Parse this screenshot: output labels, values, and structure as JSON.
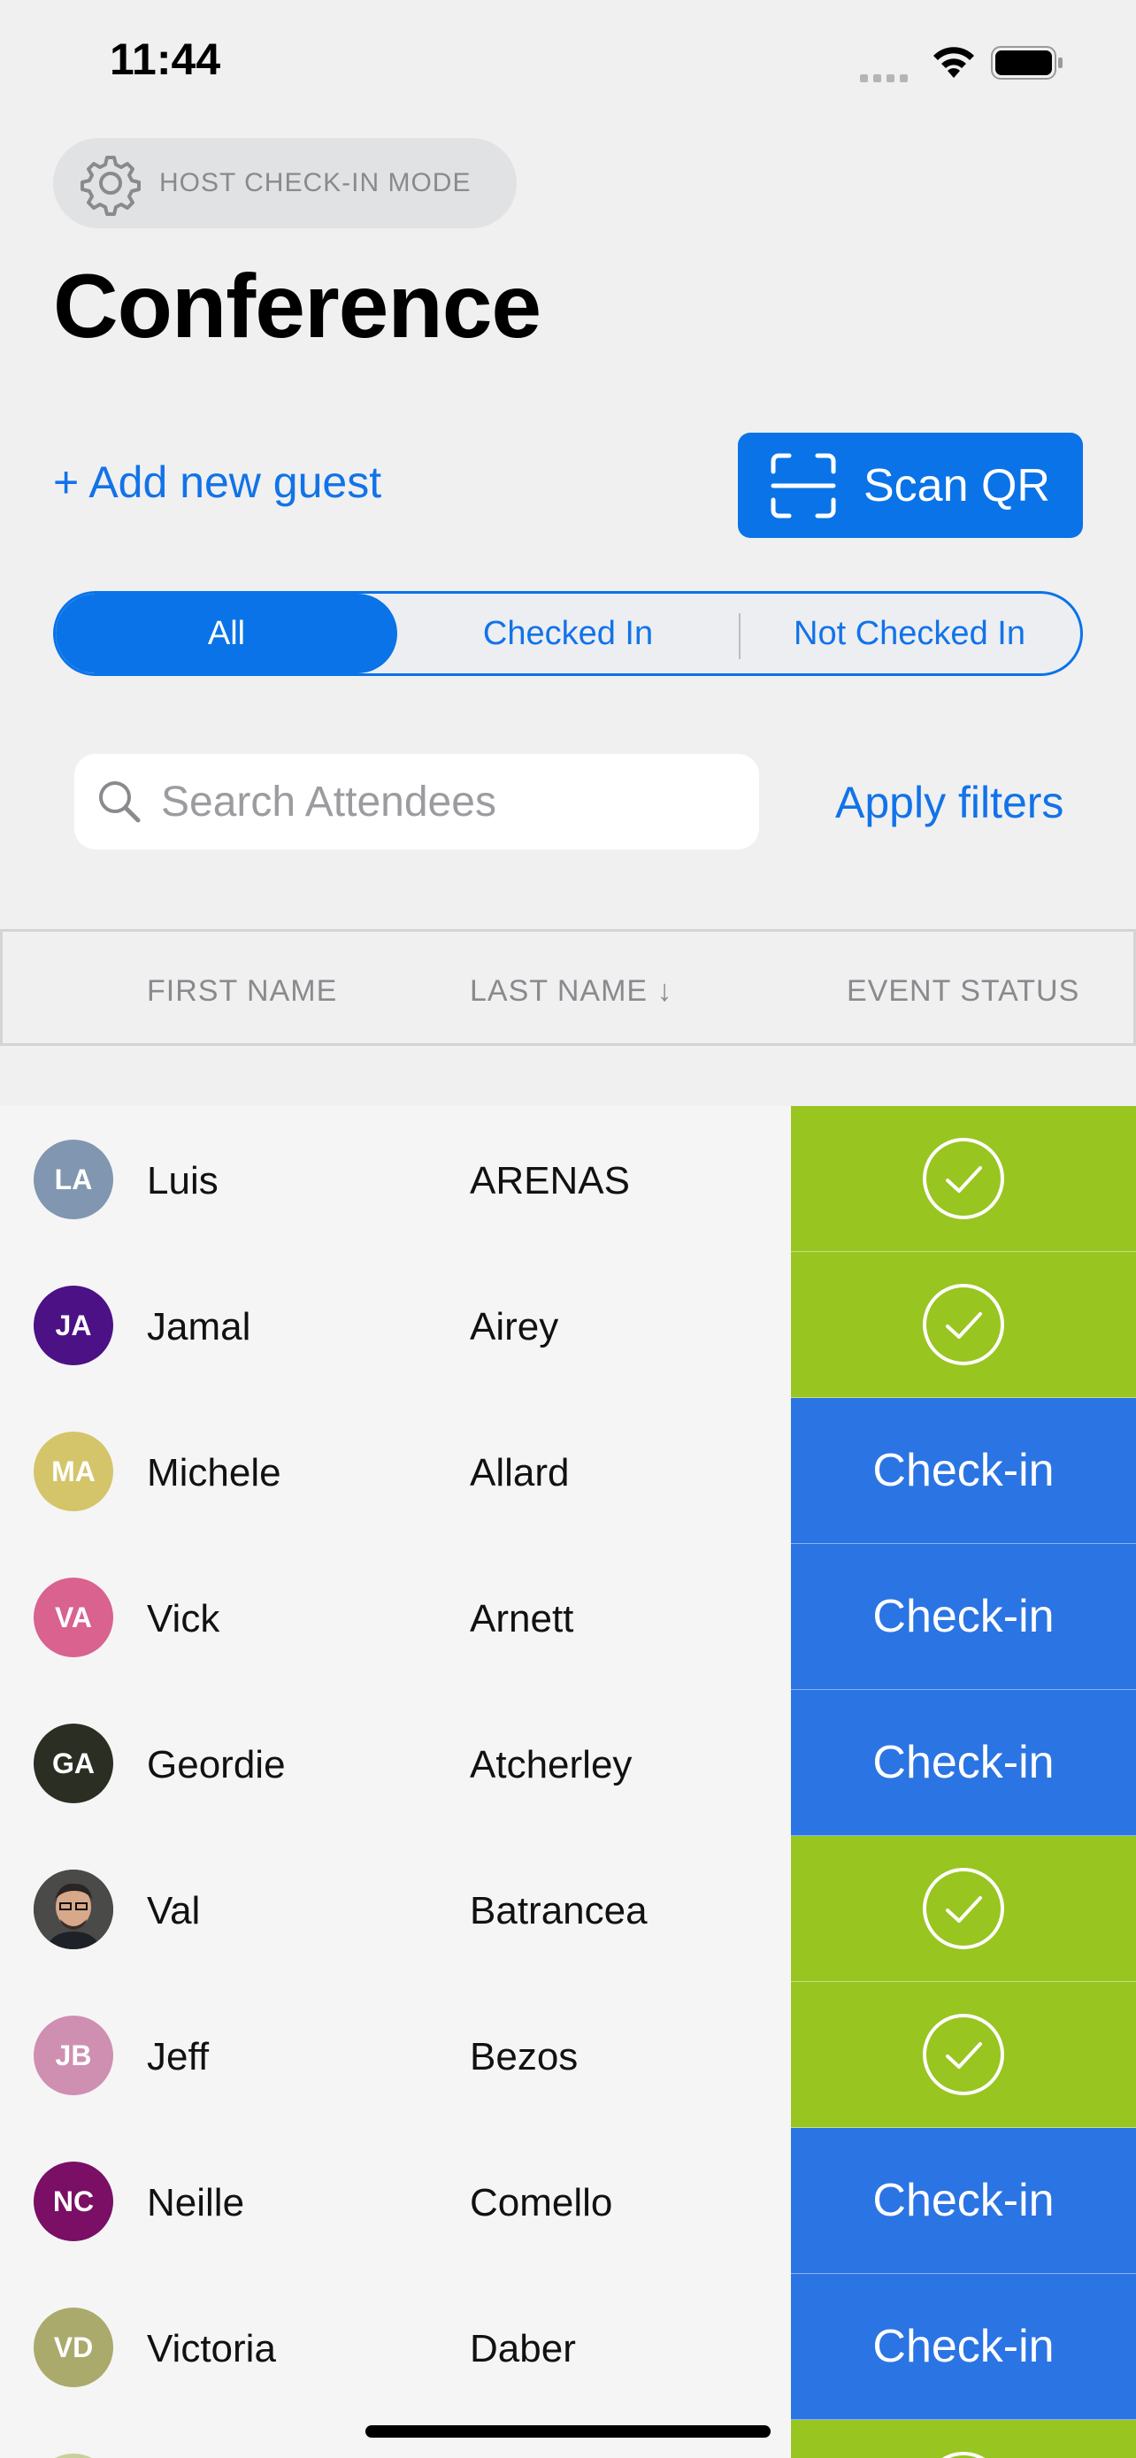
{
  "status_bar": {
    "time": "11:44"
  },
  "header": {
    "mode_label": "HOST CHECK-IN MODE",
    "title": "Conference"
  },
  "actions": {
    "add_guest": "+ Add new guest",
    "scan_qr": "Scan QR"
  },
  "segments": [
    {
      "label": "All",
      "active": true
    },
    {
      "label": "Checked In",
      "active": false
    },
    {
      "label": "Not Checked In",
      "active": false
    }
  ],
  "search": {
    "placeholder": "Search Attendees",
    "value": ""
  },
  "filters": {
    "apply_label": "Apply filters"
  },
  "table": {
    "columns": {
      "first_name": "FIRST NAME",
      "last_name": "LAST NAME ↓",
      "event_status": "EVENT STATUS"
    },
    "checkin_label": "Check-in",
    "rows": [
      {
        "initials": "LA",
        "avatar_color": "#8196b0",
        "first": "Luis",
        "last": "ARENAS",
        "checked_in": true
      },
      {
        "initials": "JA",
        "avatar_color": "#4b1185",
        "first": "Jamal",
        "last": "Airey",
        "checked_in": true
      },
      {
        "initials": "MA",
        "avatar_color": "#d4c56a",
        "first": "Michele",
        "last": "Allard",
        "checked_in": false
      },
      {
        "initials": "VA",
        "avatar_color": "#d9628f",
        "first": "Vick",
        "last": "Arnett",
        "checked_in": false
      },
      {
        "initials": "GA",
        "avatar_color": "#2b2e22",
        "first": "Geordie",
        "last": "Atcherley",
        "checked_in": false
      },
      {
        "initials": "",
        "avatar_color": "#3a3a3a",
        "photo": true,
        "first": "Val",
        "last": "Batrancea",
        "checked_in": true
      },
      {
        "initials": "JB",
        "avatar_color": "#cf8fb1",
        "first": "Jeff",
        "last": "Bezos",
        "checked_in": true
      },
      {
        "initials": "NC",
        "avatar_color": "#7a0f65",
        "first": "Neille",
        "last": "Comello",
        "checked_in": false
      },
      {
        "initials": "VD",
        "avatar_color": "#aaaa6c",
        "first": "Victoria",
        "last": "Daber",
        "checked_in": false
      },
      {
        "initials": "",
        "avatar_color": "#c9d09a",
        "first": "",
        "last": "",
        "checked_in": true
      }
    ]
  },
  "colors": {
    "accent": "#0a73e8",
    "checked_in": "#98c520",
    "checkin_button": "#2b74e3"
  }
}
